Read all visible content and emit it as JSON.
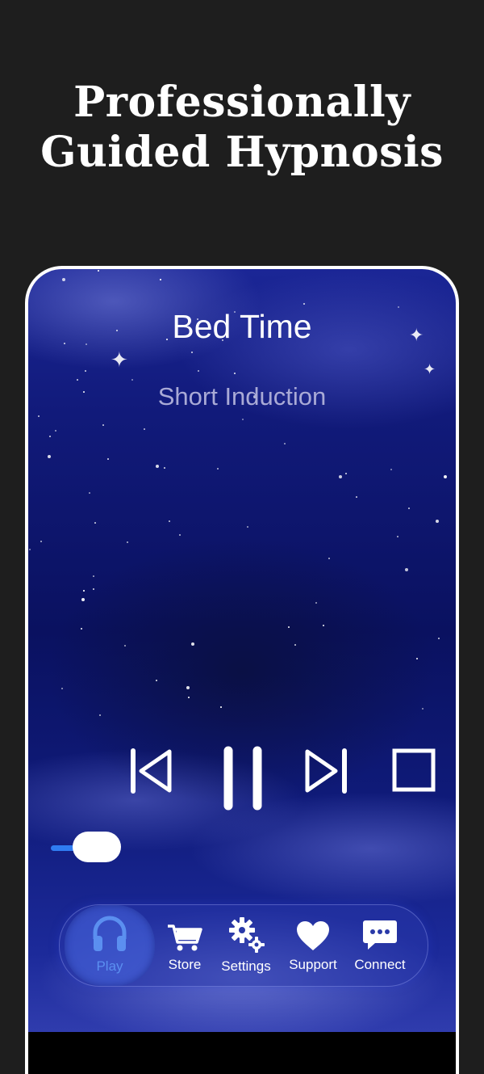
{
  "promo": {
    "title_line1": "Professionally",
    "title_line2": "Guided Hypnosis"
  },
  "player": {
    "title": "Bed Time",
    "subtitle": "Short Induction",
    "volume_level": 0.25,
    "controls": [
      "skip-back-icon",
      "pause-icon",
      "skip-forward-icon",
      "stop-icon"
    ]
  },
  "tabs": [
    {
      "label": "Play",
      "icon": "headphones-icon",
      "active": true
    },
    {
      "label": "Store",
      "icon": "cart-icon",
      "active": false
    },
    {
      "label": "Settings",
      "icon": "gears-icon",
      "active": false
    },
    {
      "label": "Support",
      "icon": "heart-icon",
      "active": false
    },
    {
      "label": "Connect",
      "icon": "chat-bubble-icon",
      "active": false
    }
  ],
  "colors": {
    "page_bg": "#1e1e1e",
    "accent_blue": "#2f7cf2",
    "active_tab_label": "#5b8ff0",
    "subtitle": "#a9aad6"
  }
}
